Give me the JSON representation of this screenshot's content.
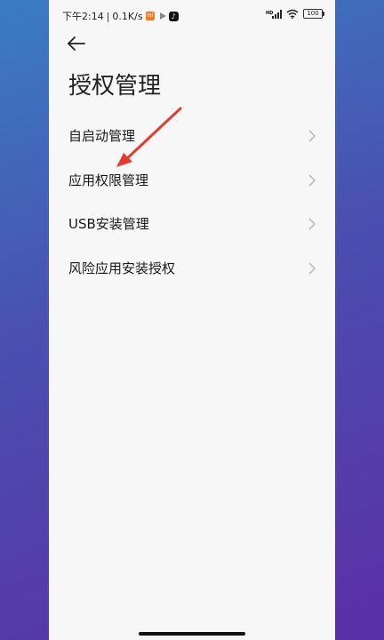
{
  "status_bar": {
    "time": "下午2:14",
    "separator": "|",
    "net_speed": "0.1K/s",
    "mi_badge": "mi",
    "battery": "100"
  },
  "header": {
    "back_icon": "arrow-left-icon",
    "title": "授权管理"
  },
  "menu": {
    "items": [
      {
        "label": "自启动管理"
      },
      {
        "label": "应用权限管理"
      },
      {
        "label": "USB安装管理"
      },
      {
        "label": "风险应用安装授权"
      }
    ],
    "chevron_icon": "chevron-right-icon"
  },
  "annotation": {
    "color": "#e53a2f"
  },
  "colors": {
    "background_top": "#3a7dc4",
    "background_bottom": "#5b2fa6",
    "screen": "#f7f7f7",
    "text": "#1a1a1a"
  }
}
